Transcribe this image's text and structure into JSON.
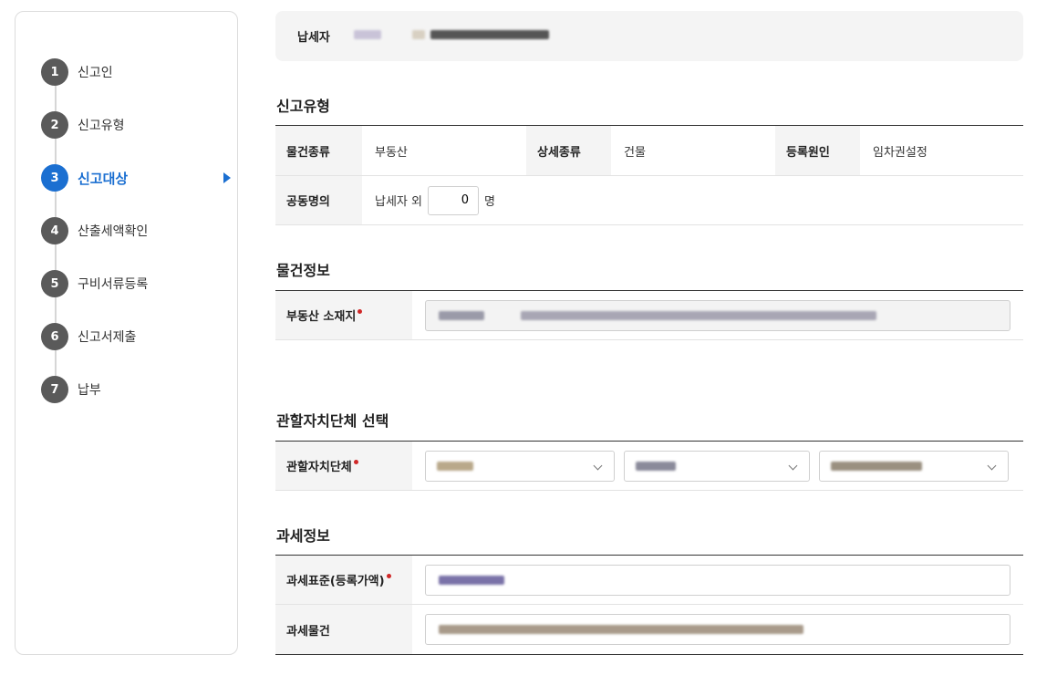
{
  "steps": [
    {
      "num": "1",
      "label": "신고인"
    },
    {
      "num": "2",
      "label": "신고유형"
    },
    {
      "num": "3",
      "label": "신고대상"
    },
    {
      "num": "4",
      "label": "산출세액확인"
    },
    {
      "num": "5",
      "label": "구비서류등록"
    },
    {
      "num": "6",
      "label": "신고서제출"
    },
    {
      "num": "7",
      "label": "납부"
    }
  ],
  "active_step": 3,
  "taxpayer": {
    "label": "납세자"
  },
  "report_type": {
    "title": "신고유형",
    "property_kind_label": "물건종류",
    "property_kind_value": "부동산",
    "detail_kind_label": "상세종류",
    "detail_kind_value": "건물",
    "reg_cause_label": "등록원인",
    "reg_cause_value": "임차권설정",
    "joint_label": "공동명의",
    "joint_prefix": "납세자 외",
    "joint_count": "0",
    "joint_suffix": "명"
  },
  "property_info": {
    "title": "물건정보",
    "address_label": "부동산 소재지"
  },
  "jurisdiction": {
    "title": "관할자치단체 선택",
    "label": "관할자치단체"
  },
  "tax_info": {
    "title": "과세정보",
    "base_label": "과세표준(등록가액)",
    "object_label": "과세물건"
  },
  "colors": {
    "accent": "#1b6fd1",
    "required": "#d02828"
  }
}
